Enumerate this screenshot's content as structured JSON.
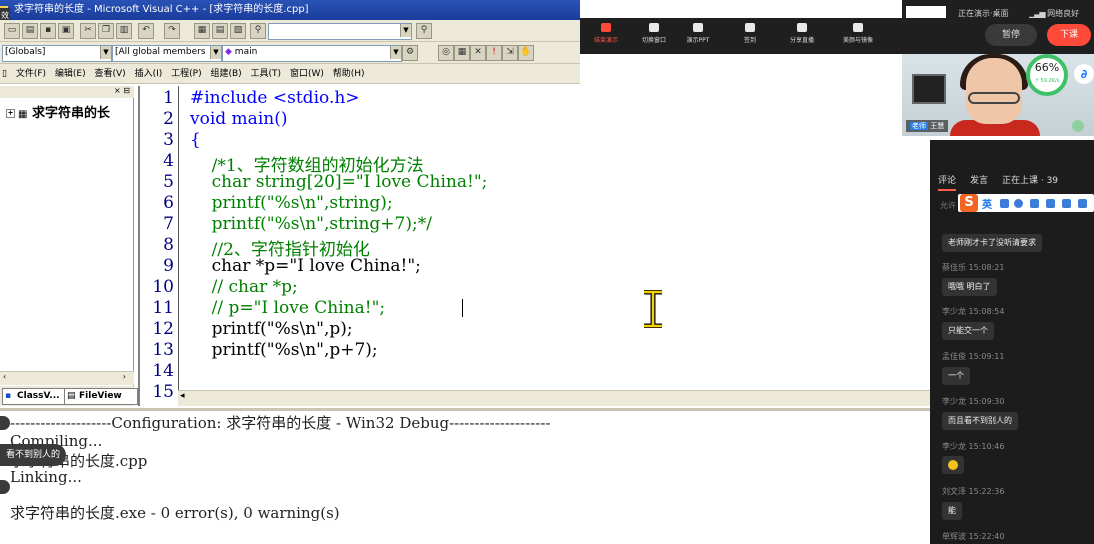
{
  "vc": {
    "title": "求字符串的长度 - Microsoft Visual C++ - [求字符串的长度.cpp]",
    "corner_char": "效",
    "toolbar": {
      "find_combo": "",
      "globals_combo": "[Globals]",
      "members_combo": "[All global members",
      "function_combo": "main"
    },
    "menu": [
      "文件(F)",
      "编辑(E)",
      "查看(V)",
      "插入(I)",
      "工程(P)",
      "组建(B)",
      "工具(T)",
      "窗口(W)",
      "帮助(H)"
    ],
    "workspace": {
      "tree_item": "求字符串的长",
      "tabs": [
        "ClassV...",
        "FileView"
      ]
    },
    "editor": {
      "line_numbers": [
        "1",
        "2",
        "3",
        "4",
        "5",
        "6",
        "7",
        "8",
        "9",
        "10",
        "11",
        "12",
        "13",
        "14",
        "15"
      ],
      "lines": [
        "#include <stdio.h>",
        "void main()",
        "{",
        "    /*1、字符数组的初始化方法",
        "    char string[20]=\"I love China!\";",
        "    printf(\"%s\\n\",string);",
        "    printf(\"%s\\n\",string+7);*/",
        "    //2、字符指针初始化",
        "    char *p=\"I love China!\";",
        "    // char *p;",
        "    // p=\"I love China!\";",
        "    printf(\"%s\\n\",p);",
        "    printf(\"%s\\n\",p+7);",
        "",
        ""
      ]
    },
    "output": {
      "lines": [
        "--------------------Configuration: 求字符串的长度 - Win32 Debug--------------------",
        "Compiling...",
        "求字符串的长度.cpp",
        "Linking...",
        "",
        "求字符串的长度.exe - 0 error(s), 0 warning(s)"
      ]
    }
  },
  "stream": {
    "buttons": [
      "结束演示",
      "切换窗口",
      "演示PPT",
      "签到",
      "分享直播",
      "美颜与镜像"
    ],
    "status": "正在演示·桌面",
    "network": "网络良好",
    "pause": "暂停",
    "end": "下课",
    "teacher_badge": "老师",
    "teacher_name": "王慧",
    "gauge_percent": "66%",
    "gauge_speed": "↑ 59.2K/s",
    "cloud_icon_char": "∂",
    "accent": "#ff4a3a"
  },
  "chat": {
    "tabs": [
      "评论",
      "发言",
      "正在上课 · 39"
    ],
    "ime_logo": "S",
    "ime_lang": "英",
    "partial_name": "允许",
    "messages": [
      {
        "author": "",
        "text": "老师刚才卡了没听清要求"
      },
      {
        "author": "蔡佳乐 15:08:21",
        "text": "哦哦 明白了"
      },
      {
        "author": "李少龙 15:08:54",
        "text": "只能交一个"
      },
      {
        "author": "孟佳俊 15:09:11",
        "text": "一个"
      },
      {
        "author": "李少龙 15:09:30",
        "text": "而且看不到别人的"
      },
      {
        "author": "李少龙 15:10:46",
        "text": ""
      },
      {
        "author": "刘文泽 15:22:36",
        "text": "能"
      },
      {
        "author": "单辉波 15:22:40",
        "text": ""
      }
    ]
  },
  "floating": {
    "bubble_text": "看不到别人的"
  }
}
